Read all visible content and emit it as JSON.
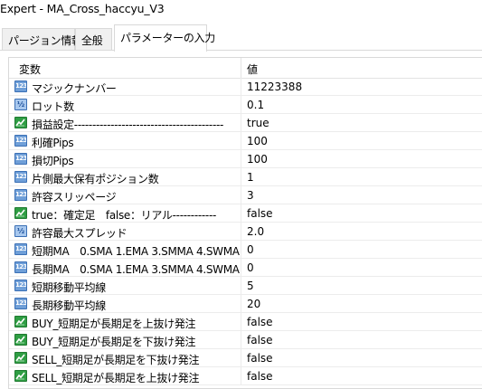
{
  "window": {
    "title": "Expert - MA_Cross_haccyu_V3"
  },
  "tabs": [
    {
      "label": "パージョン情報"
    },
    {
      "label": "全般"
    },
    {
      "label": "パラメーターの入力"
    }
  ],
  "table": {
    "headers": {
      "variable": "変数",
      "value": "値"
    },
    "rows": [
      {
        "icon": "int",
        "name": "マジックナンバー",
        "value": "11223388"
      },
      {
        "icon": "dbl",
        "name": "ロット数",
        "value": "0.1"
      },
      {
        "icon": "bool",
        "name": "損益設定-----------------------------------------",
        "value": "true"
      },
      {
        "icon": "int",
        "name": "利確Pips",
        "value": "100"
      },
      {
        "icon": "int",
        "name": "損切Pips",
        "value": "100"
      },
      {
        "icon": "int",
        "name": "片側最大保有ポジション数",
        "value": "1"
      },
      {
        "icon": "int",
        "name": "許容スリッページ",
        "value": "3"
      },
      {
        "icon": "bool",
        "name": "true：確定足　false：リアル------------",
        "value": "false"
      },
      {
        "icon": "dbl",
        "name": "許容最大スプレッド",
        "value": "2.0"
      },
      {
        "icon": "int",
        "name": "短期MA　0.SMA 1.EMA 3.SMMA 4.SWMA",
        "value": "0"
      },
      {
        "icon": "int",
        "name": "長期MA　0.SMA 1.EMA 3.SMMA 4.SWMA",
        "value": "0"
      },
      {
        "icon": "int",
        "name": "短期移動平均線",
        "value": "5"
      },
      {
        "icon": "int",
        "name": "長期移動平均線",
        "value": "20"
      },
      {
        "icon": "bool",
        "name": "BUY_短期足が長期足を上抜け発注",
        "value": "false"
      },
      {
        "icon": "bool",
        "name": "BUY_短期足が長期足を下抜け発注",
        "value": "false"
      },
      {
        "icon": "bool",
        "name": "SELL_短期足が長期足を下抜け発注",
        "value": "false"
      },
      {
        "icon": "bool",
        "name": "SELL_短期足が長期足を上抜け発注",
        "value": "false"
      }
    ]
  },
  "icons": {
    "int": {
      "name": "integer-type-icon",
      "glyph": "123"
    },
    "dbl": {
      "name": "double-type-icon",
      "glyph": "½"
    },
    "bool": {
      "name": "boolean-type-icon"
    }
  }
}
